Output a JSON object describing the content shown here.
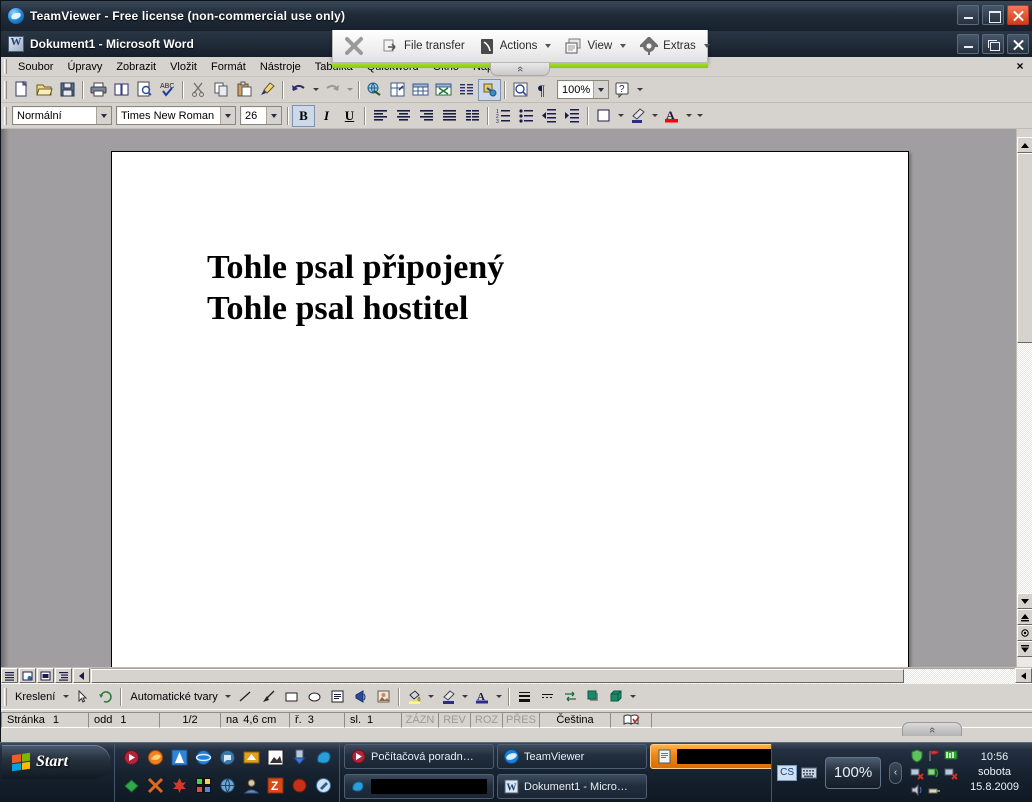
{
  "teamviewer": {
    "title": "TeamViewer - Free license (non-commercial use only)",
    "icon": "teamviewer-icon",
    "controls": {
      "minimize": "minimize-icon",
      "maximize": "maximize-icon",
      "close": "close-icon"
    },
    "controlbar": {
      "close_session": "close-session-icon",
      "items": [
        {
          "label": "File transfer",
          "icon": "file-transfer-icon",
          "has_caret": false
        },
        {
          "label": "Actions",
          "icon": "actions-icon",
          "has_caret": true
        },
        {
          "label": "View",
          "icon": "view-icon",
          "has_caret": true
        },
        {
          "label": "Extras",
          "icon": "gear-icon",
          "has_caret": true
        }
      ],
      "accent_color": "#9ed820",
      "collapse_label": "collapse-chevron-icon"
    }
  },
  "word": {
    "title": "Dokument1 - Microsoft Word",
    "icon": "word-document-icon",
    "controls": {
      "minimize": "minimize-icon",
      "restore": "restore-icon",
      "close": "close-icon"
    },
    "menu": [
      "Soubor",
      "Úpravy",
      "Zobrazit",
      "Vložit",
      "Formát",
      "Nástroje",
      "Tabulka",
      "Quickword",
      "Okno",
      "Nápověda"
    ],
    "menubar_close": "×",
    "standard_toolbar": [
      "new-document-icon",
      "open-folder-icon",
      "save-icon",
      "sep",
      "print-icon",
      "print-preview-icon",
      "page-preview-icon",
      "spellcheck-icon",
      "sep",
      "cut-scissors-icon",
      "copy-icon",
      "paste-icon",
      "format-painter-icon",
      "sep",
      "undo-icon",
      "undo-dropdown-icon",
      "redo-icon",
      "redo-dropdown-icon",
      "sep",
      "insert-hyperlink-icon",
      "tables-and-borders-icon",
      "insert-table-icon",
      "insert-excel-sheet-icon",
      "columns-icon",
      "drawing-icon",
      "sep",
      "document-map-icon",
      "show-formatting-icon"
    ],
    "zoom_value": "100%",
    "help_icon": "help-icon",
    "formatting_toolbar": {
      "style": "Normální",
      "font": "Times New Roman",
      "size": "26",
      "bold": "B",
      "italic": "I",
      "underline": "U",
      "align_icons": [
        "align-left-icon",
        "align-center-icon",
        "align-right-icon",
        "align-justify-icon",
        "align-distributed-icon"
      ],
      "list_icons": [
        "numbered-list-icon",
        "bulleted-list-icon",
        "decrease-indent-icon",
        "increase-indent-icon"
      ],
      "style_icons": [
        "borders-icon",
        "highlight-icon",
        "font-color-icon"
      ]
    },
    "document": {
      "line1": "Tohle psal připojený",
      "line2": "Tohle psal hostitel"
    },
    "view_buttons": [
      "normal-view-icon",
      "web-layout-view-icon",
      "print-layout-view-icon",
      "outline-view-icon",
      "reading-view-icon"
    ],
    "drawing_toolbar": {
      "menu_label": "Kreslení",
      "autoshapes_label": "Automatické tvary",
      "tools": [
        "select-objects-icon",
        "free-rotate-icon",
        "line-icon",
        "arrow-icon",
        "rectangle-icon",
        "oval-icon",
        "text-box-icon",
        "wordart-icon",
        "insert-picture-icon",
        "fill-color-icon",
        "line-color-icon",
        "font-color-icon",
        "line-style-icon",
        "dash-style-icon",
        "arrow-style-icon",
        "shadow-style-icon",
        "3d-style-icon"
      ]
    },
    "statusbar": {
      "page_label": "Stránka",
      "page_value": "1",
      "section_label": "odd",
      "section_value": "1",
      "pages": "1/2",
      "at_label": "na",
      "at_value": "4,6 cm",
      "line_label": "ř.",
      "line_value": "3",
      "col_label": "sl.",
      "col_value": "1",
      "modes": [
        "ZÁZN",
        "REV",
        "ROZ",
        "PŘES"
      ],
      "language": "Čeština",
      "spell_icon": "spell-status-icon"
    }
  },
  "taskbar": {
    "start_label": "Start",
    "quicklaunch": [
      "media-player-icon",
      "firefox-icon",
      "avast-icon",
      "internet-explorer-icon",
      "miranda-icon",
      "winamp-icon",
      "irfanview-icon",
      "download-icon",
      "messenger-icon",
      "emerald-icon",
      "xfire-icon",
      "maple-icon",
      "games-icon",
      "web-icon",
      "user-icon",
      "zoner-icon",
      "record-icon",
      "edit-icon"
    ],
    "tasks": [
      {
        "label": "Počítačová poradn…",
        "icon": "media-icon",
        "active": false,
        "redacted": false
      },
      {
        "label": "",
        "icon": "chat-icon",
        "active": false,
        "redacted": true
      },
      {
        "label": "TeamViewer",
        "icon": "teamviewer-icon",
        "active": false,
        "redacted": false
      },
      {
        "label": "Dokument1 - Micro…",
        "icon": "word-document-icon",
        "active": false,
        "redacted": false
      },
      {
        "label": "",
        "icon": "document-icon",
        "active": true,
        "redacted": true
      }
    ],
    "tray": {
      "language": "CS",
      "keyboard_icon": "keyboard-icon",
      "zoom": "100%",
      "expander_icon": "chevron-left-icon",
      "icons": [
        "shield-icon",
        "flag-icon",
        "monitor-icon",
        "network-error-icon",
        "wireless-icon",
        "network-disconnected-icon",
        "sound-icon",
        "usb-icon"
      ],
      "time": "10:56",
      "day": "sobota",
      "date": "15.8.2009"
    }
  }
}
